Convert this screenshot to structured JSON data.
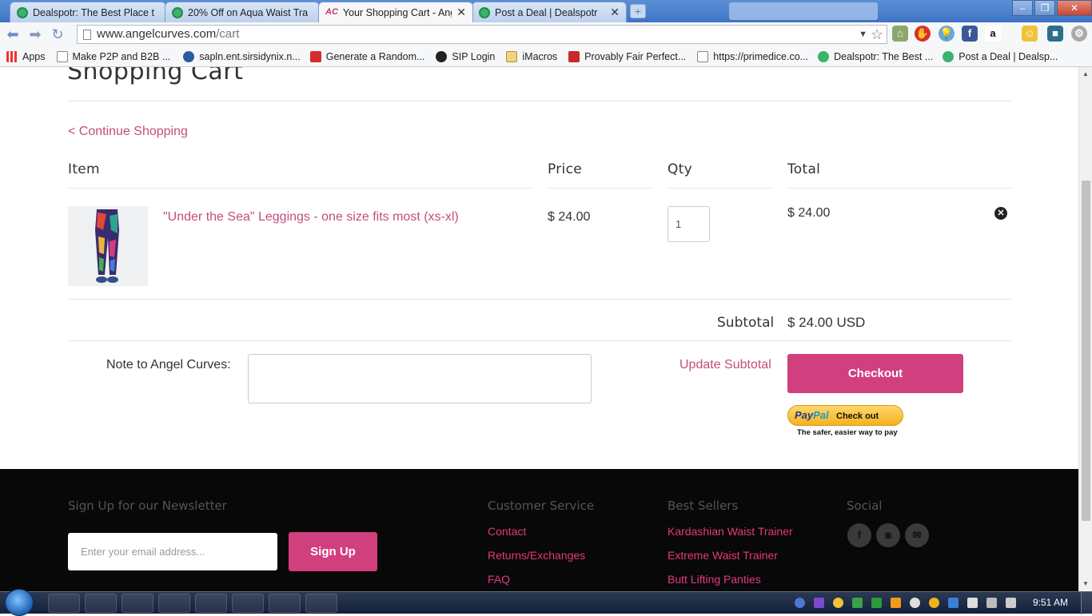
{
  "browser": {
    "tabs": [
      {
        "title": "Dealspotr: The Best Place t",
        "icon": "dealspotr-icon"
      },
      {
        "title": "20% Off on Aqua Waist Tra",
        "icon": "dealspotr-icon"
      },
      {
        "title": "Your Shopping Cart - Ange",
        "icon": "angelcurves-icon",
        "active": true
      },
      {
        "title": "Post a Deal | Dealspotr",
        "icon": "dealspotr-icon"
      }
    ],
    "url_host": "www.angelcurves.com",
    "url_path": "/cart",
    "bookmarks": [
      {
        "label": "Apps",
        "icon": "apps-grid-icon"
      },
      {
        "label": "Make P2P and B2B ...",
        "icon": "page-icon"
      },
      {
        "label": "sapln.ent.sirsidynix.n...",
        "icon": "globe-icon"
      },
      {
        "label": "Generate a Random...",
        "icon": "red-f-icon"
      },
      {
        "label": "SIP Login",
        "icon": "sip-icon"
      },
      {
        "label": "iMacros",
        "icon": "folder-icon"
      },
      {
        "label": "Provably Fair Perfect...",
        "icon": "dice-icon"
      },
      {
        "label": "https://primedice.co...",
        "icon": "page-icon"
      },
      {
        "label": "Dealspotr: The Best ...",
        "icon": "dealspotr-icon"
      },
      {
        "label": "Post a Deal | Dealsp...",
        "icon": "dealspotr-icon"
      }
    ]
  },
  "cart": {
    "title": "Shopping Cart",
    "continue": "< Continue Shopping",
    "headers": {
      "item": "Item",
      "price": "Price",
      "qty": "Qty",
      "total": "Total"
    },
    "items": [
      {
        "name": "\"Under the Sea\" Leggings - one size fits most (xs-xl)",
        "price": "$ 24.00",
        "qty": "1",
        "total": "$ 24.00"
      }
    ],
    "subtotal_label": "Subtotal",
    "subtotal_value": "$ 24.00 USD",
    "note_label": "Note to Angel Curves:",
    "update_label": "Update Subtotal",
    "checkout_label": "Checkout",
    "paypal": {
      "brand_a": "Pay",
      "brand_b": "Pal",
      "action": "Check out",
      "tagline": "The safer, easier way to pay"
    }
  },
  "footer": {
    "newsletter_heading": "Sign Up for our Newsletter",
    "email_placeholder": "Enter your email address...",
    "signup_label": "Sign Up",
    "customer_service": {
      "heading": "Customer Service",
      "links": [
        "Contact",
        "Returns/Exchanges",
        "FAQ"
      ]
    },
    "best_sellers": {
      "heading": "Best Sellers",
      "links": [
        "Kardashian Waist Trainer",
        "Extreme Waist Trainer",
        "Butt Lifting Panties"
      ]
    },
    "social": {
      "heading": "Social",
      "icons": [
        "f",
        "◙",
        "✉"
      ]
    }
  },
  "taskbar": {
    "clock": "9:51 AM"
  },
  "colors": {
    "accent": "#d23f7e",
    "link": "#c24e7f"
  }
}
